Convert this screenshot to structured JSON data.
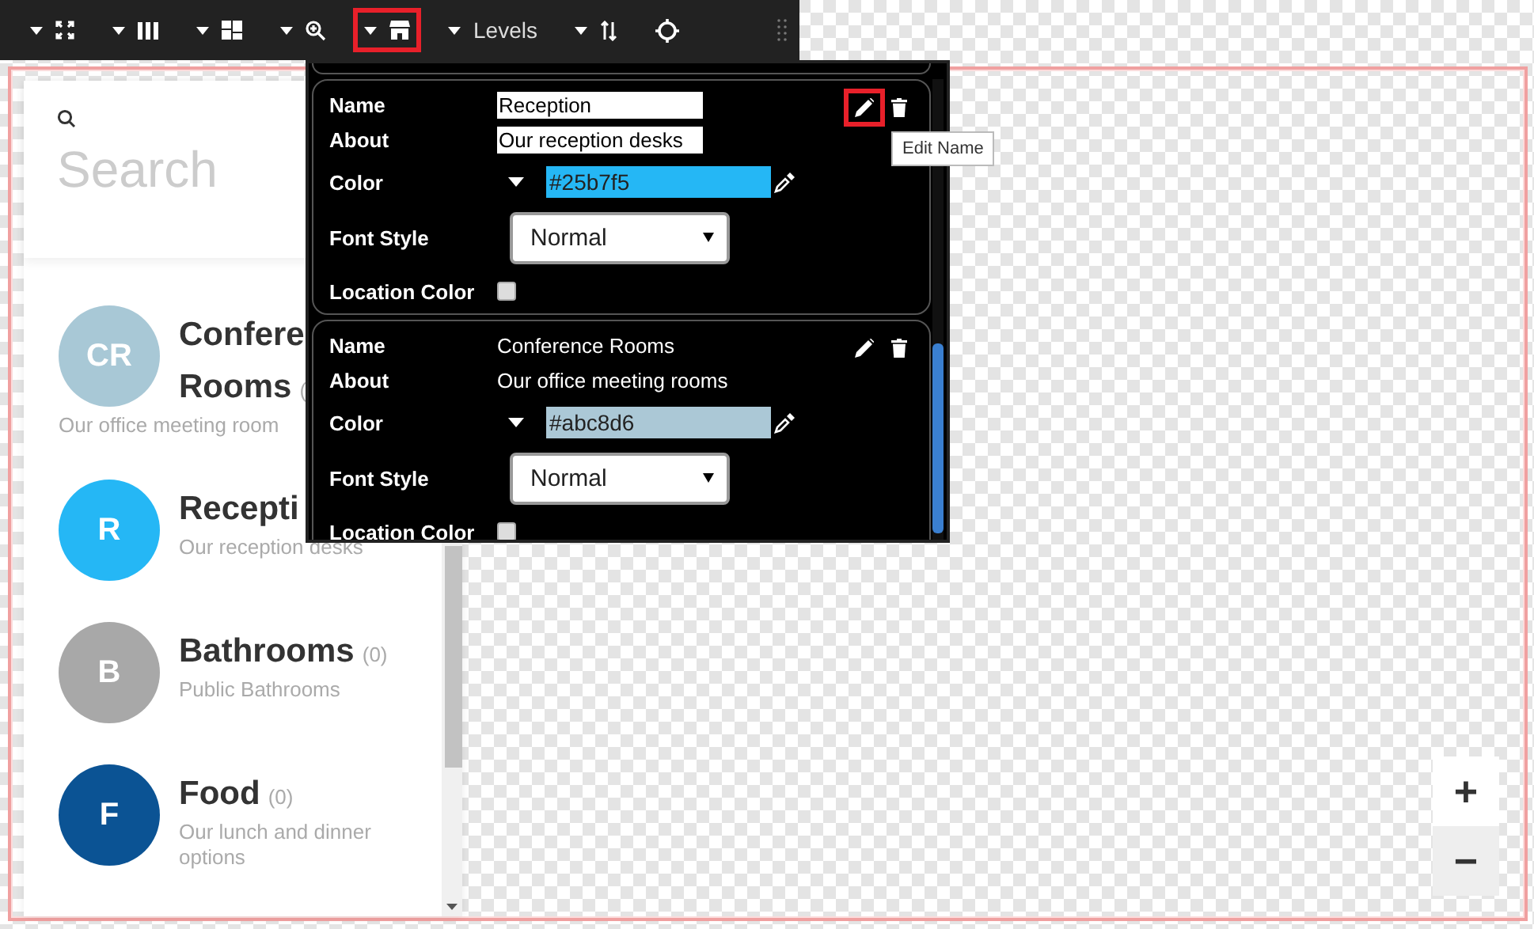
{
  "toolbar": {
    "groups": [
      {
        "kind": "fullscreen",
        "highlighted": false
      },
      {
        "kind": "columns",
        "highlighted": false
      },
      {
        "kind": "grid",
        "highlighted": false
      },
      {
        "kind": "zoom",
        "highlighted": false
      },
      {
        "kind": "store",
        "highlighted": true
      },
      {
        "kind": "text",
        "highlighted": false,
        "label": "Levels"
      },
      {
        "kind": "sort",
        "highlighted": false
      },
      {
        "kind": "target",
        "highlighted": false
      }
    ]
  },
  "sidebar": {
    "search": {
      "placeholder": "Search"
    },
    "items": [
      {
        "initials": "CR",
        "color": "#a8c8d6",
        "name_lines": [
          "Confere",
          "Rooms"
        ],
        "count": "(",
        "description": "Our office meeting room"
      },
      {
        "initials": "R",
        "color": "#25b7f5",
        "name_lines": [
          "Recepti"
        ],
        "description": "Our reception desks"
      },
      {
        "initials": "B",
        "color": "#a8a8a8",
        "name_lines": [
          "Bathrooms"
        ],
        "count": "(0)",
        "description": "Public Bathrooms"
      },
      {
        "initials": "F",
        "color": "#0b5394",
        "name_lines": [
          "Food"
        ],
        "count": "(0)",
        "description": "Our lunch and dinner options"
      }
    ]
  },
  "editor": {
    "cards": [
      {
        "label_name": "Name",
        "label_about": "About",
        "label_color": "Color",
        "label_font_style": "Font Style",
        "label_location_color": "Location Color",
        "editing": true,
        "edit_highlighted": true,
        "name": "Reception",
        "about": "Our reception desks",
        "color": "#25b7f5",
        "font_style": "Normal",
        "location_color": false
      },
      {
        "label_name": "Name",
        "label_about": "About",
        "label_color": "Color",
        "label_font_style": "Font Style",
        "label_location_color": "Location Color",
        "editing": false,
        "edit_highlighted": false,
        "name": "Conference Rooms",
        "about": "Our office meeting rooms",
        "color": "#abc8d6",
        "font_style": "Normal",
        "location_color": false
      }
    ]
  },
  "tooltip": {
    "text": "Edit Name"
  },
  "zoom": {
    "plus": "+",
    "minus": "−"
  }
}
